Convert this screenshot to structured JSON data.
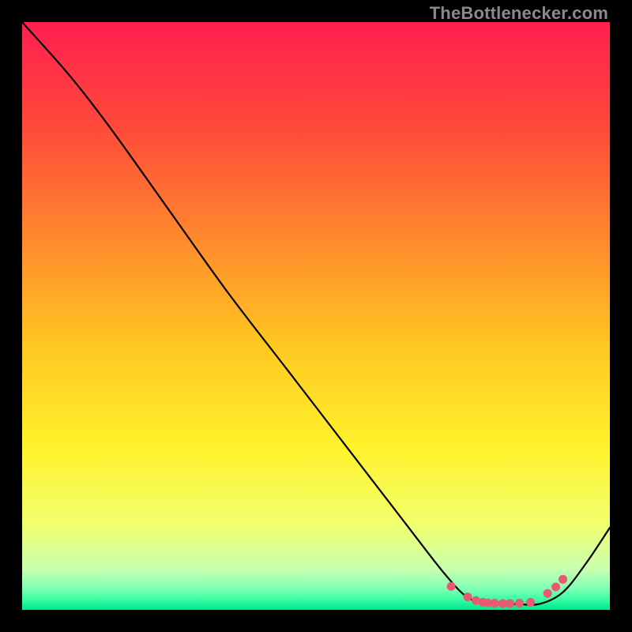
{
  "watermark": "TheBottleneсker.com",
  "chart_data": {
    "type": "line",
    "title": "",
    "xlabel": "",
    "ylabel": "",
    "xlim": [
      0,
      100
    ],
    "ylim": [
      0,
      100
    ],
    "grid": false,
    "legend": false,
    "series": [
      {
        "name": "curve",
        "x": [
          0,
          8,
          15,
          25,
          35,
          45,
          55,
          65,
          72,
          76,
          80,
          84,
          88,
          92,
          96,
          100
        ],
        "y": [
          100,
          91,
          82,
          68,
          54,
          41,
          28,
          15,
          6,
          2,
          1,
          1,
          1,
          3,
          8,
          14
        ]
      }
    ],
    "markers": {
      "name": "dots",
      "x": [
        73.0,
        75.8,
        77.2,
        78.4,
        79.2,
        80.4,
        81.8,
        83.0,
        84.6,
        86.5,
        89.4,
        90.8,
        92.0
      ],
      "y": [
        4.0,
        2.2,
        1.6,
        1.3,
        1.2,
        1.15,
        1.1,
        1.1,
        1.15,
        1.3,
        2.8,
        3.9,
        5.2
      ]
    },
    "gradient_stops": [
      {
        "offset": 0.0,
        "color": "#ff1f4f"
      },
      {
        "offset": 0.18,
        "color": "#ff4a3a"
      },
      {
        "offset": 0.38,
        "color": "#ff8d2c"
      },
      {
        "offset": 0.55,
        "color": "#ffc722"
      },
      {
        "offset": 0.72,
        "color": "#fff22a"
      },
      {
        "offset": 0.85,
        "color": "#f2ff6a"
      },
      {
        "offset": 0.93,
        "color": "#c9ffb0"
      },
      {
        "offset": 0.965,
        "color": "#7dffb4"
      },
      {
        "offset": 0.985,
        "color": "#2dfca0"
      },
      {
        "offset": 1.0,
        "color": "#00e58b"
      }
    ],
    "colors": {
      "curve": "#000000",
      "markers": "#e85a6f"
    }
  }
}
